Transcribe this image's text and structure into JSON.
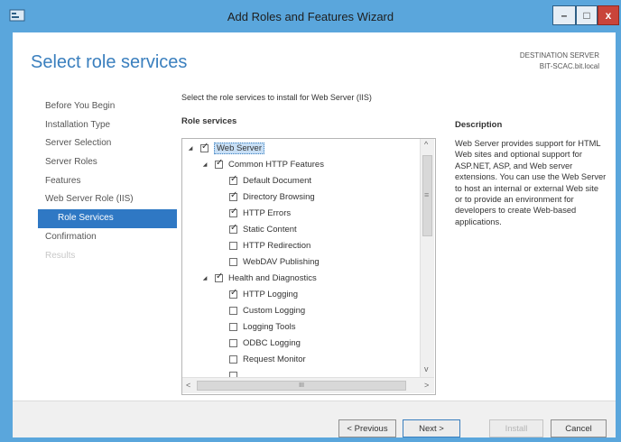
{
  "window": {
    "title": "Add Roles and Features Wizard",
    "minimize": "–",
    "maximize": "□",
    "close": "x"
  },
  "header": {
    "page_title": "Select role services",
    "destination_label": "DESTINATION SERVER",
    "destination_server": "BIT-SCAC.bit.local"
  },
  "nav": {
    "items": [
      {
        "label": "Before You Begin"
      },
      {
        "label": "Installation Type"
      },
      {
        "label": "Server Selection"
      },
      {
        "label": "Server Roles"
      },
      {
        "label": "Features"
      },
      {
        "label": "Web Server Role (IIS)"
      },
      {
        "label": "Role Services"
      },
      {
        "label": "Confirmation"
      },
      {
        "label": "Results"
      }
    ],
    "active": "Role Services"
  },
  "main": {
    "instruction": "Select the role services to install for Web Server (IIS)",
    "role_services_label": "Role services",
    "tree": [
      {
        "label": "Web Server",
        "checked": true,
        "expander": "◢",
        "level": 0
      },
      {
        "label": "Common HTTP Features",
        "checked": true,
        "expander": "◢",
        "level": 1
      },
      {
        "label": "Default Document",
        "checked": true,
        "level": 2
      },
      {
        "label": "Directory Browsing",
        "checked": true,
        "level": 2
      },
      {
        "label": "HTTP Errors",
        "checked": true,
        "level": 2
      },
      {
        "label": "Static Content",
        "checked": true,
        "level": 2
      },
      {
        "label": "HTTP Redirection",
        "checked": false,
        "level": 2
      },
      {
        "label": "WebDAV Publishing",
        "checked": false,
        "level": 2
      },
      {
        "label": "Health and Diagnostics",
        "checked": true,
        "expander": "◢",
        "level": 1
      },
      {
        "label": "HTTP Logging",
        "checked": true,
        "level": 2
      },
      {
        "label": "Custom Logging",
        "checked": false,
        "level": 2
      },
      {
        "label": "Logging Tools",
        "checked": false,
        "level": 2
      },
      {
        "label": "ODBC Logging",
        "checked": false,
        "level": 2
      },
      {
        "label": "Request Monitor",
        "checked": false,
        "level": 2
      }
    ],
    "scroll": {
      "up": "^",
      "down": "v",
      "left": "<",
      "right": ">",
      "grip": "III",
      "vgrip": "≡"
    }
  },
  "description": {
    "title": "Description",
    "text": "Web Server provides support for HTML Web sites and optional support for ASP.NET, ASP, and Web server extensions. You can use the Web Server to host an internal or external Web site or to provide an environment for developers to create Web-based applications."
  },
  "footer": {
    "previous": "< Previous",
    "next": "Next >",
    "install": "Install",
    "cancel": "Cancel"
  },
  "colors": {
    "frame": "#5aa6dc",
    "accent": "#3a7fbe",
    "nav_active": "#2f78c4"
  }
}
